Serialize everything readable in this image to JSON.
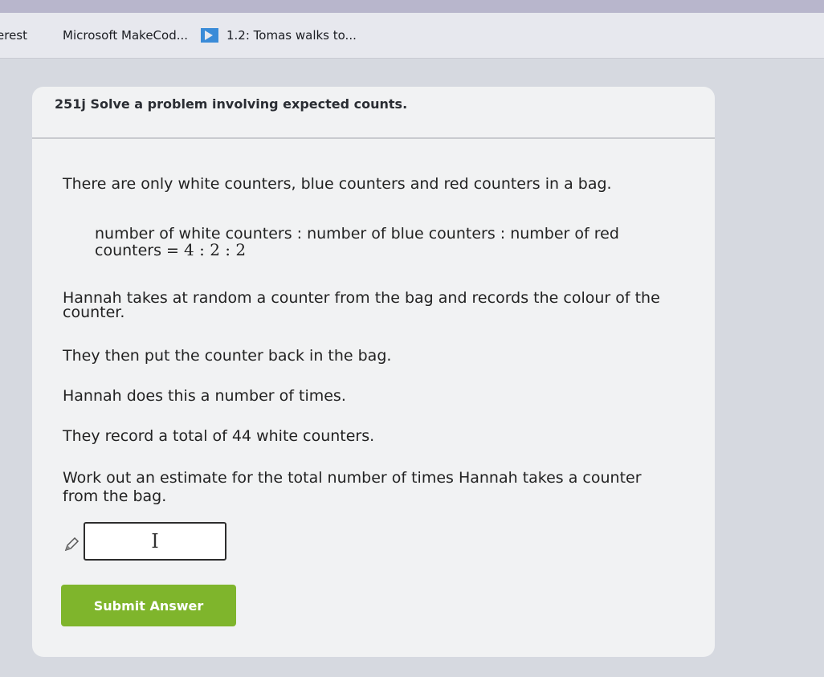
{
  "bookmarks": {
    "items": [
      {
        "label": "erest"
      },
      {
        "label": "Microsoft MakeCod...",
        "icon": "makecode-icon"
      },
      {
        "label": "1.2: Tomas walks to...",
        "icon": "sigma-icon"
      }
    ]
  },
  "card": {
    "title": "251j Solve a problem involving expected counts."
  },
  "question": {
    "intro": "There are only white counters, blue counters and red counters in a bag.",
    "ratio_text_line1": "number of white counters : number of blue counters : number of red",
    "ratio_text_line2": "counters =",
    "ratio_value": "4 : 2 : 2",
    "line3a": "Hannah takes at random a counter from the bag and records the colour of the",
    "line3b": "counter.",
    "line4": "They then put the counter back in the bag.",
    "line5": "Hannah does this a number of times.",
    "line6": "They record a total of 44 white counters.",
    "line7a": "Work out an estimate for the total number of times Hannah takes a counter",
    "line7b": "from the bag."
  },
  "answer": {
    "value": "",
    "cursor_glyph": "I"
  },
  "submit": {
    "label": "Submit Answer"
  },
  "colors": {
    "accent": "#7fb52c",
    "card_bg": "#f1f2f3"
  }
}
